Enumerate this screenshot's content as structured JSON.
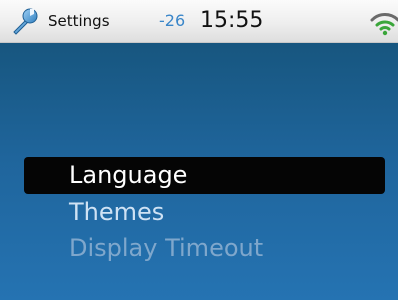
{
  "status_bar": {
    "app_icon": "wrench-icon",
    "title": "Settings",
    "signal_level": "-26",
    "clock": "15:55",
    "wifi_icon": "wifi-icon"
  },
  "menu": {
    "items": [
      {
        "label": "Language",
        "state": "selected"
      },
      {
        "label": "Themes",
        "state": "normal"
      },
      {
        "label": "Display Timeout",
        "state": "disabled"
      }
    ]
  },
  "colors": {
    "background_top": "#17567f",
    "background_bottom": "#2573b2",
    "selection": "#050505",
    "signal_text": "#3a86c9",
    "disabled_text": "#7fa7cc"
  }
}
